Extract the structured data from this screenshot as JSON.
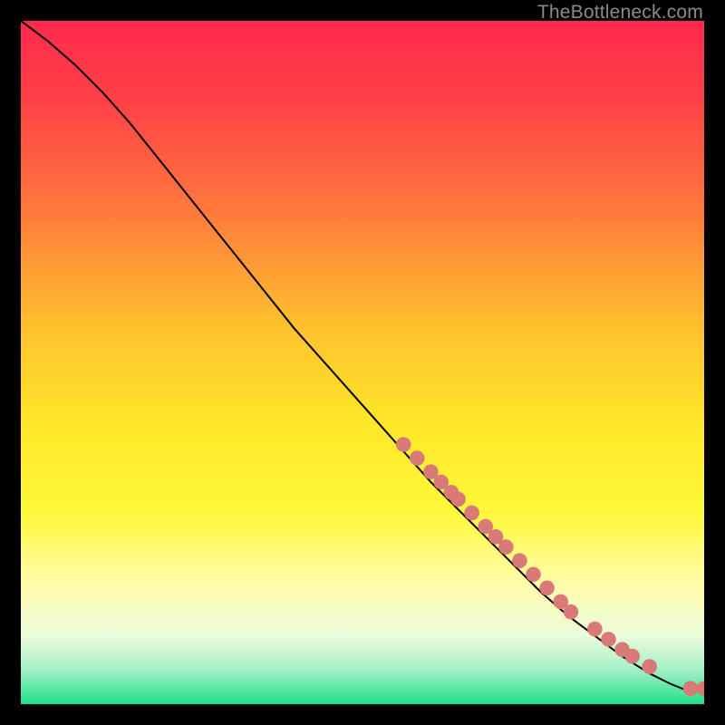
{
  "watermark": "TheBottleneck.com",
  "chart_data": {
    "type": "line",
    "title": "",
    "xlabel": "",
    "ylabel": "",
    "xlim": [
      0,
      100
    ],
    "ylim": [
      0,
      100
    ],
    "grid": false,
    "legend_position": "none",
    "background_gradient": {
      "stops": [
        {
          "y_pct": 0,
          "color": "#ff2a4d"
        },
        {
          "y_pct": 12,
          "color": "#ff4147"
        },
        {
          "y_pct": 28,
          "color": "#ff7a3c"
        },
        {
          "y_pct": 45,
          "color": "#ffc22e"
        },
        {
          "y_pct": 60,
          "color": "#ffe92a"
        },
        {
          "y_pct": 72,
          "color": "#fff83a"
        },
        {
          "y_pct": 82,
          "color": "#fffca8"
        },
        {
          "y_pct": 90,
          "color": "#ecfcdc"
        },
        {
          "y_pct": 95,
          "color": "#a4f0c8"
        },
        {
          "y_pct": 100,
          "color": "#1ee089"
        }
      ]
    },
    "series": [
      {
        "name": "curve",
        "stroke": "#000000",
        "x": [
          0,
          4,
          8,
          12,
          16,
          20,
          24,
          28,
          32,
          36,
          40,
          44,
          48,
          52,
          56,
          60,
          64,
          68,
          72,
          76,
          80,
          84,
          88,
          92,
          95,
          97,
          98.5,
          100
        ],
        "y": [
          100,
          97,
          93.5,
          89.5,
          85,
          80,
          75,
          70,
          65,
          60,
          55,
          50.5,
          46,
          41.5,
          37,
          32.5,
          28.5,
          24.5,
          20.5,
          16.5,
          13,
          10,
          7,
          4.5,
          3,
          2.2,
          2,
          2
        ]
      }
    ],
    "markers": {
      "color": "#d97a78",
      "radius_pct": 1.1,
      "points": [
        {
          "x": 56,
          "y": 38
        },
        {
          "x": 58,
          "y": 36
        },
        {
          "x": 60,
          "y": 34
        },
        {
          "x": 61.5,
          "y": 32.5
        },
        {
          "x": 63,
          "y": 31
        },
        {
          "x": 64,
          "y": 30
        },
        {
          "x": 66,
          "y": 28
        },
        {
          "x": 68,
          "y": 26
        },
        {
          "x": 69.5,
          "y": 24.5
        },
        {
          "x": 71,
          "y": 23
        },
        {
          "x": 73,
          "y": 21
        },
        {
          "x": 75,
          "y": 19
        },
        {
          "x": 77,
          "y": 17
        },
        {
          "x": 79,
          "y": 15
        },
        {
          "x": 80.5,
          "y": 13.5
        },
        {
          "x": 84,
          "y": 11
        },
        {
          "x": 86,
          "y": 9.5
        },
        {
          "x": 88,
          "y": 8
        },
        {
          "x": 89.5,
          "y": 7
        },
        {
          "x": 92,
          "y": 5.5
        },
        {
          "x": 98,
          "y": 2.3
        },
        {
          "x": 100,
          "y": 2.3
        }
      ]
    }
  }
}
